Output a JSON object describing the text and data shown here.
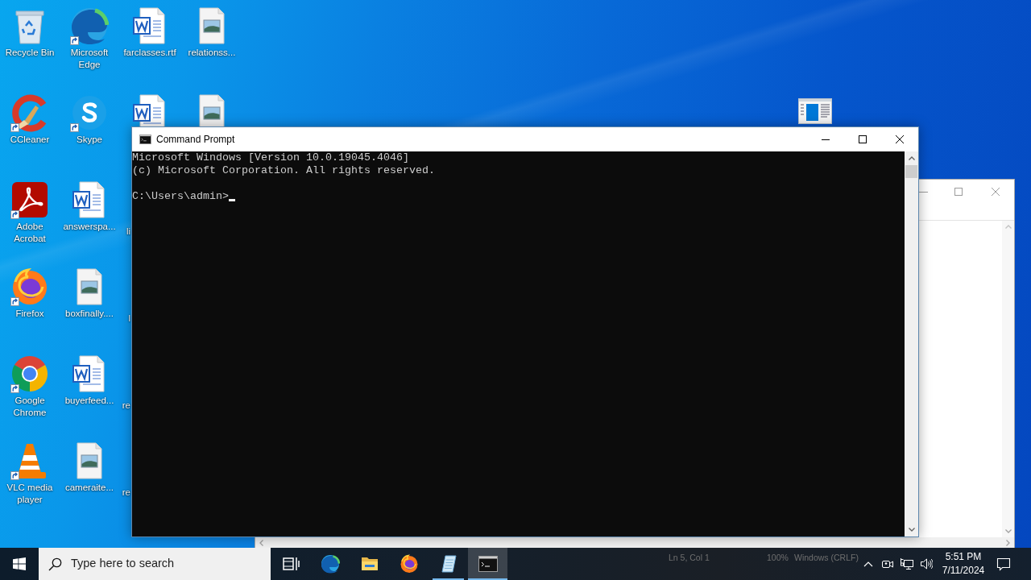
{
  "desktop": {
    "columns": [
      {
        "items": [
          {
            "kind": "recycle-bin",
            "label": "Recycle Bin",
            "shortcut": false
          },
          {
            "kind": "ccleaner",
            "label": "CCleaner",
            "shortcut": true
          },
          {
            "kind": "acrobat",
            "label": "Adobe Acrobat",
            "shortcut": true
          },
          {
            "kind": "firefox",
            "label": "Firefox",
            "shortcut": true
          },
          {
            "kind": "chrome",
            "label": "Google Chrome",
            "shortcut": true
          },
          {
            "kind": "vlc",
            "label": "VLC media player",
            "shortcut": true
          }
        ]
      },
      {
        "items": [
          {
            "kind": "edge",
            "label": "Microsoft Edge",
            "shortcut": true
          },
          {
            "kind": "skype",
            "label": "Skype",
            "shortcut": true
          },
          {
            "kind": "word",
            "label": "answerspa...",
            "shortcut": false
          },
          {
            "kind": "image",
            "label": "boxfinally....",
            "shortcut": false
          },
          {
            "kind": "word",
            "label": "buyerfeed...",
            "shortcut": false
          },
          {
            "kind": "image",
            "label": "cameraite...",
            "shortcut": false
          }
        ]
      },
      {
        "items": [
          {
            "kind": "word",
            "label": "farclasses.rtf",
            "shortcut": false
          },
          {
            "kind": "word",
            "shortcut": false
          },
          {
            "label": "li"
          },
          {
            "label": "l"
          },
          {
            "label": "re"
          },
          {
            "label": "re"
          }
        ]
      },
      {
        "items": [
          {
            "kind": "image",
            "label": "relationss...",
            "shortcut": false
          },
          {
            "kind": "image",
            "shortcut": false
          }
        ]
      }
    ],
    "loose_icons": [
      {
        "kind": "window"
      }
    ]
  },
  "command_prompt": {
    "title": "Command Prompt",
    "output": [
      "Microsoft Windows [Version 10.0.19045.4046]",
      "(c) Microsoft Corporation. All rights reserved."
    ],
    "prompt": "C:\\Users\\admin>"
  },
  "background_window": {
    "status_bar": [
      "Ln 5, Col 1",
      "100%",
      "Windows (CRLF)"
    ]
  },
  "taskbar": {
    "search": {
      "placeholder": "Type here to search"
    },
    "apps": [
      {
        "kind": "task-view",
        "running": false,
        "active": false
      },
      {
        "kind": "edge",
        "running": false,
        "active": false
      },
      {
        "kind": "explorer",
        "running": false,
        "active": false
      },
      {
        "kind": "firefox",
        "running": false,
        "active": false
      },
      {
        "kind": "notepad",
        "running": true,
        "active": false
      },
      {
        "kind": "cmd",
        "running": true,
        "active": true
      }
    ],
    "clock": {
      "time": "5:51 PM",
      "date": "7/11/2024"
    }
  }
}
